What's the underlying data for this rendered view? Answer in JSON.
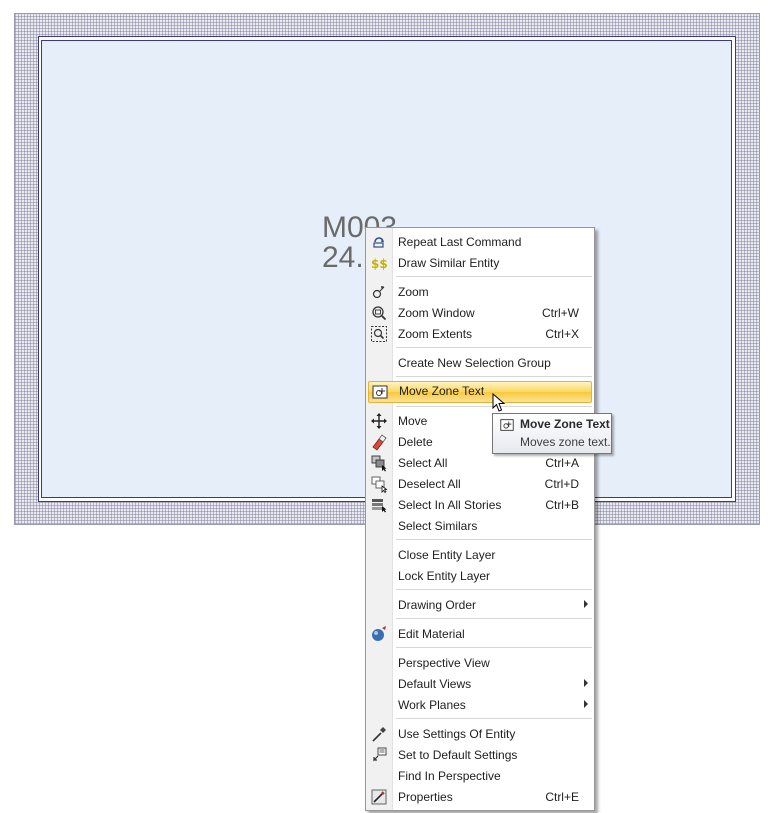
{
  "zone": {
    "name_text": "M003",
    "area_text": "24."
  },
  "menu": {
    "items": [
      {
        "label": "Repeat Last Command",
        "shortcut": "",
        "icon": "repeat-icon"
      },
      {
        "label": "Draw Similar Entity",
        "shortcut": "",
        "icon": "draw-similar-icon"
      },
      {
        "label": "Zoom",
        "shortcut": "",
        "icon": "zoom-icon"
      },
      {
        "label": "Zoom Window",
        "shortcut": "Ctrl+W",
        "icon": "zoom-window-icon"
      },
      {
        "label": "Zoom Extents",
        "shortcut": "Ctrl+X",
        "icon": "zoom-extents-icon"
      },
      {
        "label": "Create New Selection Group",
        "shortcut": ""
      },
      {
        "label": "Move Zone Text",
        "shortcut": "",
        "icon": "move-zone-text-icon",
        "highlighted": true
      },
      {
        "label": "Move",
        "shortcut": "",
        "icon": "move-icon"
      },
      {
        "label": "Delete",
        "shortcut": "",
        "icon": "eraser-icon"
      },
      {
        "label": "Select All",
        "shortcut": "Ctrl+A",
        "icon": "select-all-icon"
      },
      {
        "label": "Deselect All",
        "shortcut": "Ctrl+D",
        "icon": "deselect-all-icon"
      },
      {
        "label": "Select In All Stories",
        "shortcut": "Ctrl+B",
        "icon": "select-stories-icon"
      },
      {
        "label": "Select Similars",
        "shortcut": ""
      },
      {
        "label": "Close Entity Layer",
        "shortcut": ""
      },
      {
        "label": "Lock Entity Layer",
        "shortcut": ""
      },
      {
        "label": "Drawing Order",
        "shortcut": "",
        "submenu": true
      },
      {
        "label": "Edit Material",
        "shortcut": "",
        "icon": "material-icon"
      },
      {
        "label": "Perspective View",
        "shortcut": ""
      },
      {
        "label": "Default Views",
        "shortcut": "",
        "submenu": true
      },
      {
        "label": "Work Planes",
        "shortcut": "",
        "submenu": true
      },
      {
        "label": "Use Settings Of Entity",
        "shortcut": "",
        "icon": "eyedropper-icon"
      },
      {
        "label": "Set to Default Settings",
        "shortcut": "",
        "icon": "default-settings-icon"
      },
      {
        "label": "Find In Perspective",
        "shortcut": ""
      },
      {
        "label": "Properties",
        "shortcut": "Ctrl+E",
        "icon": "properties-icon"
      }
    ]
  },
  "tooltip": {
    "title": "Move Zone Text",
    "description": "Moves zone text."
  },
  "colors": {
    "zone_fill": "#e6eef9",
    "zone_border": "#3a3a8a",
    "highlight": "#f8c93a"
  }
}
